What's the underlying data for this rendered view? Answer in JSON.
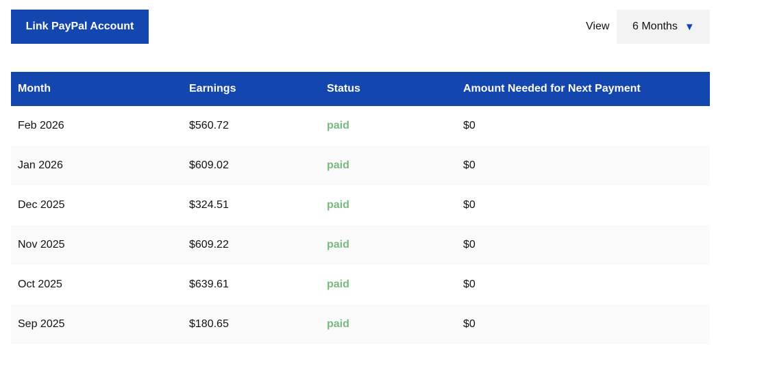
{
  "toolbar": {
    "link_button_label": "Link PayPal Account",
    "view_label": "View",
    "view_selected": "6 Months",
    "view_arrow_icon": "triangle-down-icon"
  },
  "colors": {
    "accent": "#1446b0",
    "paid": "#79b97d"
  },
  "table": {
    "headers": [
      "Month",
      "Earnings",
      "Status",
      "Amount Needed for Next Payment"
    ],
    "rows": [
      {
        "month": "Feb 2026",
        "earnings": "$560.72",
        "status": "paid",
        "amount_needed": "$0"
      },
      {
        "month": "Jan 2026",
        "earnings": "$609.02",
        "status": "paid",
        "amount_needed": "$0"
      },
      {
        "month": "Dec 2025",
        "earnings": "$324.51",
        "status": "paid",
        "amount_needed": "$0"
      },
      {
        "month": "Nov 2025",
        "earnings": "$609.22",
        "status": "paid",
        "amount_needed": "$0"
      },
      {
        "month": "Oct 2025",
        "earnings": "$639.61",
        "status": "paid",
        "amount_needed": "$0"
      },
      {
        "month": "Sep 2025",
        "earnings": "$180.65",
        "status": "paid",
        "amount_needed": "$0"
      }
    ]
  }
}
